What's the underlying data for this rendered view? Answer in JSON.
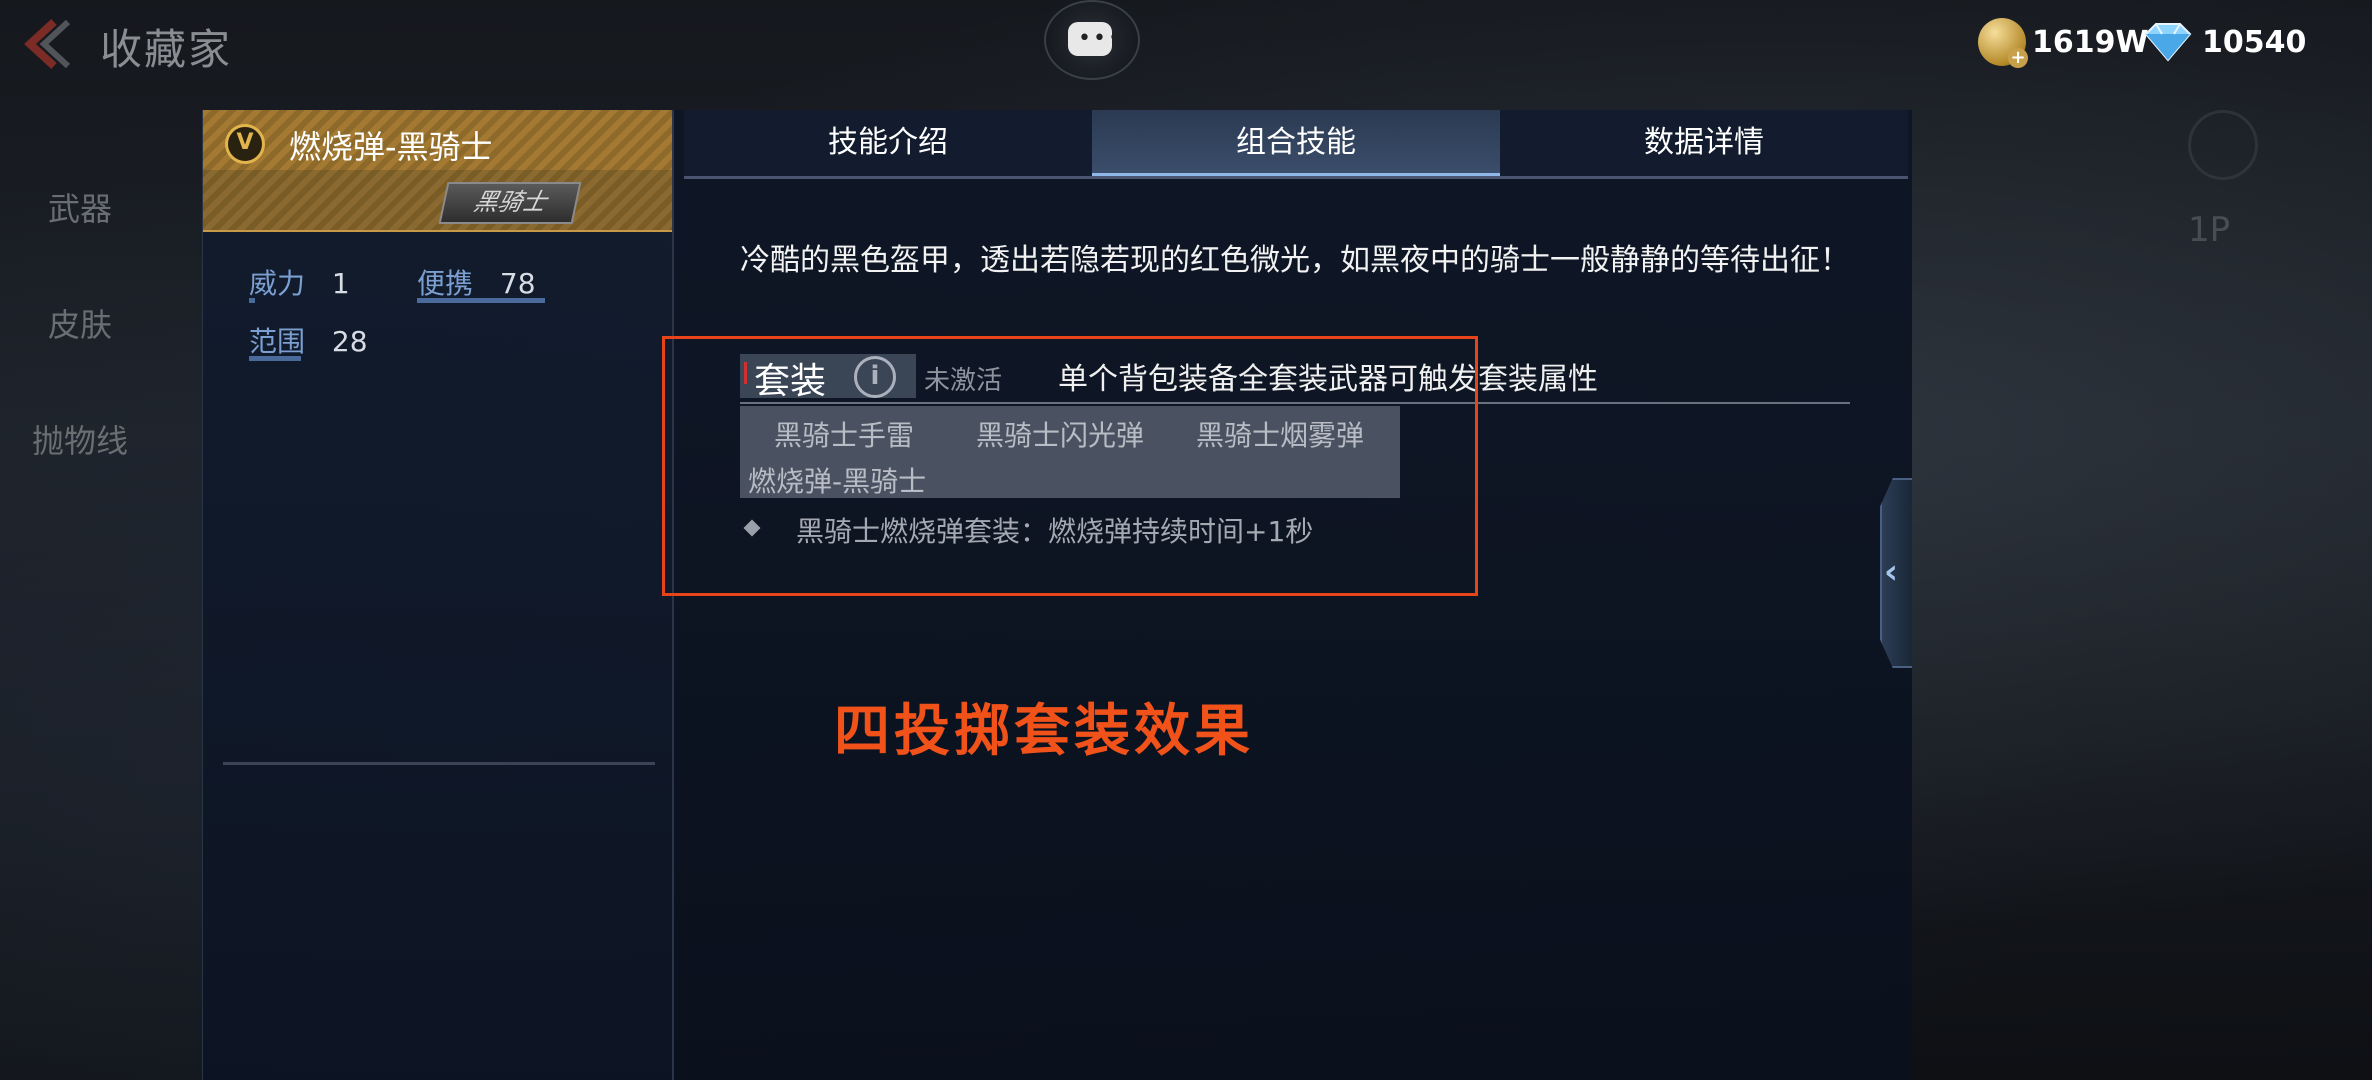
{
  "header": {
    "title": "收藏家",
    "currency_gold": "1619W",
    "currency_diamond": "10540"
  },
  "side_nav": {
    "items": [
      {
        "label": "武器"
      },
      {
        "label": "皮肤"
      },
      {
        "label": "抛物线"
      }
    ]
  },
  "right_faded": {
    "label": "1P"
  },
  "weapon": {
    "badge": "V",
    "name": "燃烧弹-黑骑士",
    "tag": "黑骑士",
    "stats": [
      {
        "label": "威力",
        "value": "1"
      },
      {
        "label": "便携",
        "value": "78"
      },
      {
        "label": "范围",
        "value": "28"
      }
    ]
  },
  "tabs": [
    {
      "label": "技能介绍",
      "active": false
    },
    {
      "label": "组合技能",
      "active": true
    },
    {
      "label": "数据详情",
      "active": false
    }
  ],
  "skill": {
    "description": "冷酷的黑色盔甲，透出若隐若现的红色微光，如黑夜中的骑士一般静静的等待出征！",
    "set_title": "套装",
    "set_status": "未激活",
    "set_hint": "单个背包装备全套装武器可触发套装属性",
    "set_items": [
      "黑骑士手雷",
      "黑骑士闪光弹",
      "黑骑士烟雾弹",
      "燃烧弹-黑骑士"
    ],
    "set_effect": "黑骑士燃烧弹套装：燃烧弹持续时间+1秒"
  },
  "overlay_caption": "四投掷套装效果",
  "colors": {
    "accent_orange": "#e8441a",
    "caption_orange": "#f0521a",
    "gold": "#c79a4a"
  }
}
